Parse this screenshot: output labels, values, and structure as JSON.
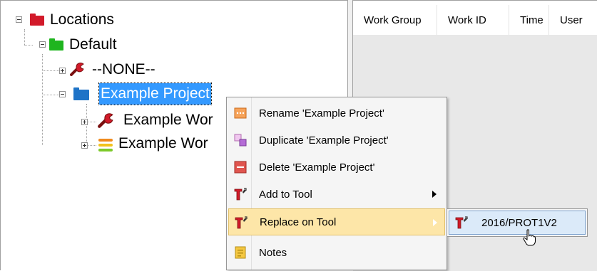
{
  "tree": {
    "nodes": [
      {
        "label": "Locations"
      },
      {
        "label": "Default"
      },
      {
        "label": "--NONE--"
      },
      {
        "label": "Example Project"
      },
      {
        "label": "Example Wor"
      },
      {
        "label": "Example Wor"
      }
    ]
  },
  "list": {
    "columns": [
      "Work Group",
      "Work ID",
      "Time",
      "User"
    ]
  },
  "context_menu": {
    "items": [
      {
        "label": "Rename 'Example Project'"
      },
      {
        "label": "Duplicate 'Example Project'"
      },
      {
        "label": "Delete 'Example Project'"
      },
      {
        "label": "Add to Tool"
      },
      {
        "label": "Replace on Tool"
      },
      {
        "label": "Notes"
      }
    ],
    "submenu": {
      "label": "2016/PROT1V2"
    }
  },
  "icons": {
    "root_folder": "folder-icon",
    "default_folder": "folder-icon",
    "project_folder": "folder-icon",
    "tool_item": "wrench-icon",
    "stack_item": "stack-icon",
    "rename": "rename-icon",
    "duplicate": "duplicate-icon",
    "delete": "delete-icon",
    "add_tool": "tool-icon",
    "replace_tool": "tool-icon",
    "notes": "notes-icon"
  },
  "colors": {
    "selection": "#3399ff",
    "menu_hot": "#fde6a8",
    "submenu_hot": "#dbeaf9",
    "root_folder": "#d21a2a",
    "default_folder": "#1fb51f",
    "project_folder": "#1e73c7"
  }
}
